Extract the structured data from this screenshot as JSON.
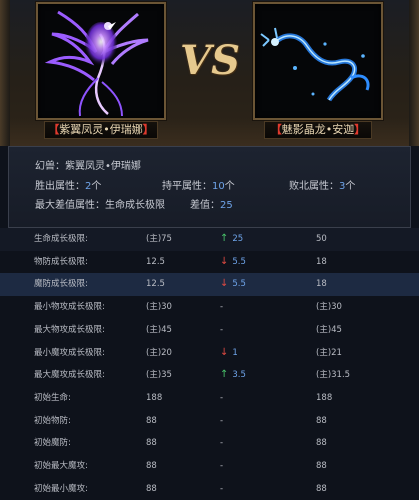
{
  "header": {
    "vs_label": "VS",
    "left_name": "紫翼凤灵•伊瑞娜",
    "right_name": "魅影晶龙•安迦",
    "bracket_open": "【",
    "bracket_close": "】"
  },
  "info": {
    "beast_label": "幻兽：",
    "beast_name": "紫翼凤灵•伊瑞娜",
    "win_label": "胜出属性：",
    "win_count": "2",
    "unit": "个",
    "draw_label": "持平属性：",
    "draw_count": "10",
    "lose_label": "败北属性：",
    "lose_count": "3",
    "maxdiff_label": "最大差值属性：生命成长极限",
    "diff_label": "差值：",
    "diff_value": "25"
  },
  "table": {
    "rows": [
      {
        "label": "生命成长极限:",
        "left": "(主)75",
        "diff_dir": "up",
        "diff": "25",
        "right": "50"
      },
      {
        "label": "物防成长极限:",
        "left": "12.5",
        "diff_dir": "down",
        "diff": "5.5",
        "right": "18"
      },
      {
        "label": "魔防成长极限:",
        "left": "12.5",
        "diff_dir": "down",
        "diff": "5.5",
        "right": "18"
      },
      {
        "label": "最小物攻成长极限:",
        "left": "(主)30",
        "diff_dir": "none",
        "diff": "-",
        "right": "(主)30"
      },
      {
        "label": "最大物攻成长极限:",
        "left": "(主)45",
        "diff_dir": "none",
        "diff": "-",
        "right": "(主)45"
      },
      {
        "label": "最小魔攻成长极限:",
        "left": "(主)20",
        "diff_dir": "down",
        "diff": "1",
        "right": "(主)21"
      },
      {
        "label": "最大魔攻成长极限:",
        "left": "(主)35",
        "diff_dir": "up",
        "diff": "3.5",
        "right": "(主)31.5"
      },
      {
        "label": "初始生命:",
        "left": "188",
        "diff_dir": "none",
        "diff": "-",
        "right": "188"
      },
      {
        "label": "初始物防:",
        "left": "88",
        "diff_dir": "none",
        "diff": "-",
        "right": "88"
      },
      {
        "label": "初始魔防:",
        "left": "88",
        "diff_dir": "none",
        "diff": "-",
        "right": "88"
      },
      {
        "label": "初始最大魔攻:",
        "left": "88",
        "diff_dir": "none",
        "diff": "-",
        "right": "88"
      },
      {
        "label": "初始最小魔攻:",
        "left": "88",
        "diff_dir": "none",
        "diff": "-",
        "right": "88"
      }
    ]
  },
  "colors": {
    "accent_gold": "#e6c98e",
    "highlight_blue": "#6ea3e8",
    "up_green": "#49c46b",
    "down_red": "#e04a42",
    "selected_row": "#1d2a42"
  },
  "icons": {
    "left_portrait": "purple-phoenix-image",
    "right_portrait": "blue-dragon-image",
    "up": "up-arrow-icon",
    "down": "down-arrow-icon"
  }
}
